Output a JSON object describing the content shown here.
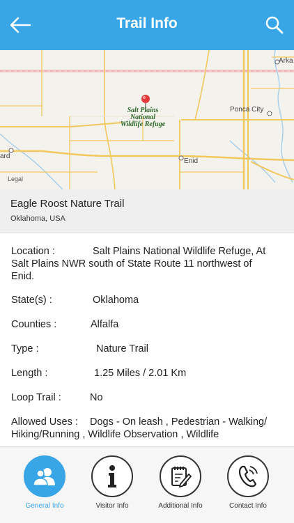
{
  "header": {
    "title": "Trail Info",
    "back_icon": "arrow-left-icon",
    "search_icon": "search-icon"
  },
  "map": {
    "labels": {
      "arka": "Arka",
      "ponca_city": "Ponca City",
      "enid": "Enid",
      "ard": "ard",
      "refuge": "Salt Plains National Wildlife Refuge"
    },
    "refuge_lines": [
      "Salt Plains",
      "National",
      "Wildlife Refuge"
    ],
    "legal": "Legal",
    "pin_color": "#e23a3a"
  },
  "trail": {
    "name": "Eagle Roost Nature Trail",
    "location": "Oklahoma, USA"
  },
  "info": {
    "location": {
      "label": "Location  :",
      "value_line1": "Salt Plains National Wildlife Refuge, At",
      "value_rest": "Salt Plains NWR south of State Route 11 northwest of",
      "value_end": "Enid."
    },
    "state": {
      "label": "State(s)  :",
      "value": "Oklahoma"
    },
    "counties": {
      "label": "Counties  :",
      "value": "Alfalfa"
    },
    "type": {
      "label": "Type  :",
      "value": "Nature Trail"
    },
    "length": {
      "label": "Length  :",
      "value": "1.25 Miles / 2.01 Km"
    },
    "loop": {
      "label": "Loop Trail  :",
      "value": "No"
    },
    "allowed": {
      "label": "Allowed Uses  :",
      "value_line1": "Dogs - On leash , Pedestrian - Walking/",
      "value_line2": "Hiking/Running , Wildlife Observation , Wildlife"
    }
  },
  "tabs": [
    {
      "label": "General Info",
      "icon": "users-icon",
      "active": true
    },
    {
      "label": "Visitor Info",
      "icon": "info-icon",
      "active": false
    },
    {
      "label": "Additional Info",
      "icon": "document-edit-icon",
      "active": false
    },
    {
      "label": "Contact Info",
      "icon": "phone-icon",
      "active": false
    }
  ],
  "colors": {
    "accent": "#38a6e6",
    "road": "#f2c75c"
  }
}
